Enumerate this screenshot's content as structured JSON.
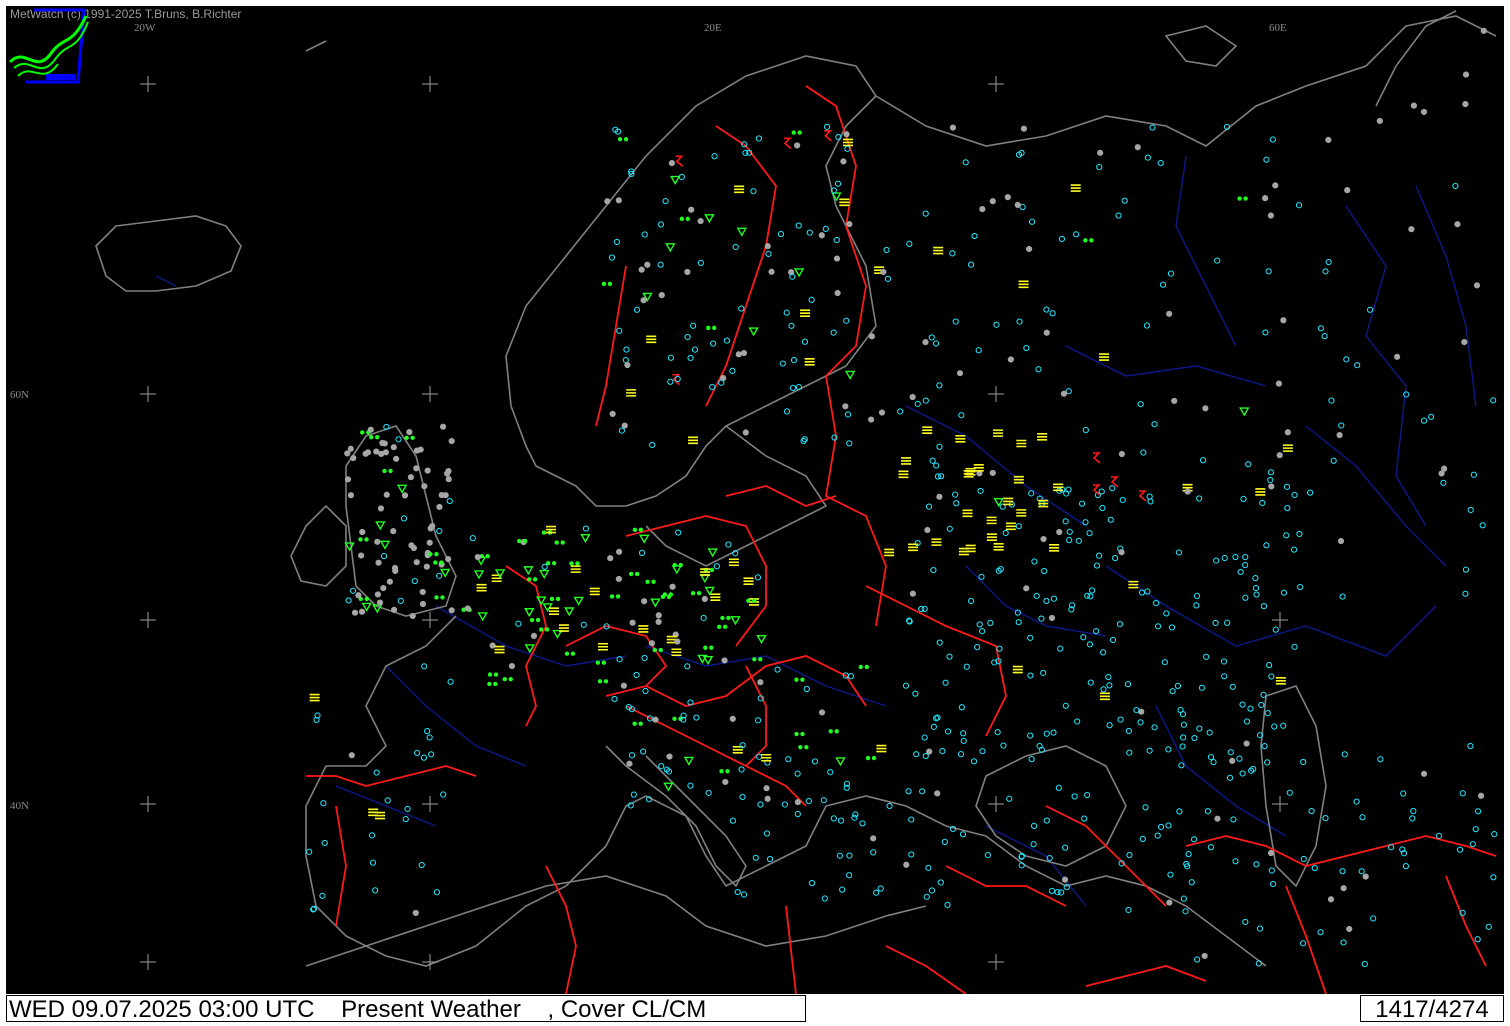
{
  "app": {
    "copyright": "MetWatch  (c) 1991-2025 T.Bruns, B.Richter",
    "logo_icon": "metwatch-logo-icon"
  },
  "grid_labels": {
    "lon_20w": "20W",
    "lon_20e": "20E",
    "lon_60e": "60E",
    "lat_60n": "60N",
    "lat_40n": "40N"
  },
  "status": {
    "datetime": "WED 09.07.2025 03:00 UTC",
    "product": "Present Weather",
    "cover": ", Cover CL/CM",
    "station_count": "1417/4274"
  },
  "colors": {
    "background": "#000000",
    "coastline": "#808080",
    "borders": "#ff0000",
    "rivers": "#000080",
    "station_clear": "#00ffff",
    "station_overcast": "#a0a0a0",
    "precip_green": "#00ff00",
    "fog_yellow": "#ffff00",
    "thunder_red": "#ff0000"
  }
}
